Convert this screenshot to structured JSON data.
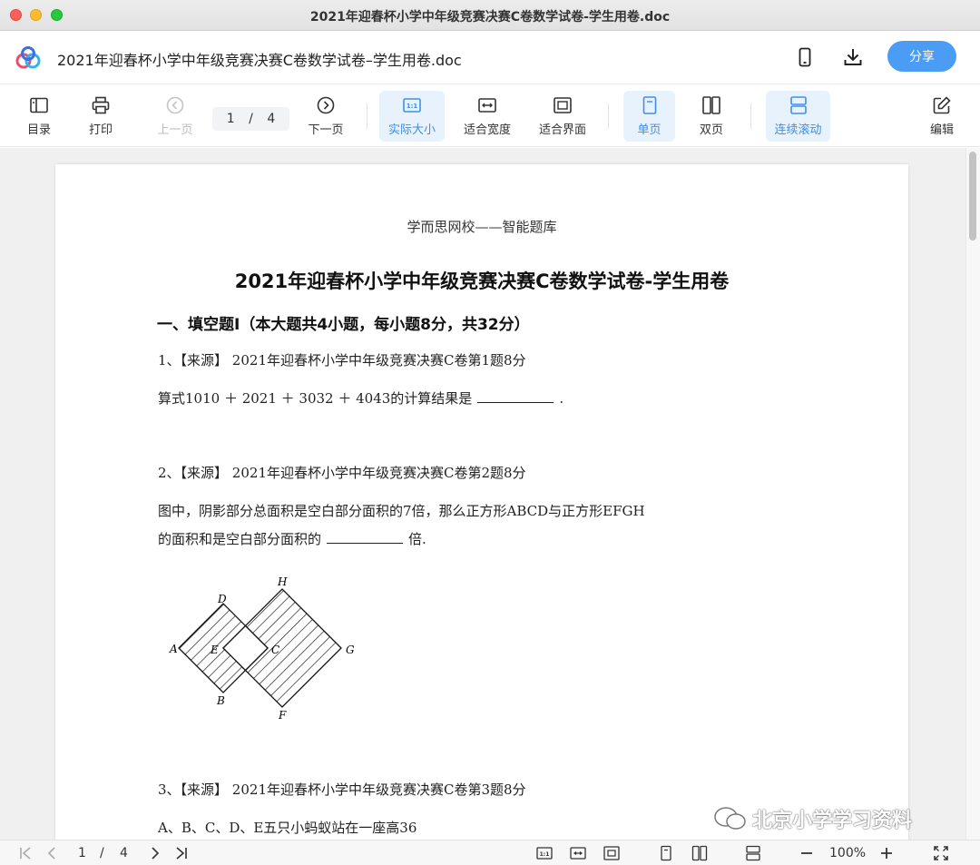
{
  "window": {
    "title": "2021年迎春杯小学中年级竞赛决赛C卷数学试卷-学生用卷.doc"
  },
  "header": {
    "doc_name": "2021年迎春杯小学中年级竞赛决赛C卷数学试卷–学生用卷.doc",
    "share_label": "分享"
  },
  "toolbar": {
    "toc": "目录",
    "print": "打印",
    "prev": "上一页",
    "page_current": "1",
    "page_sep": "/",
    "page_total": "4",
    "next": "下一页",
    "actual_size": "实际大小",
    "fit_width": "适合宽度",
    "fit_screen": "适合界面",
    "single": "单页",
    "double": "双页",
    "continuous": "连续滚动",
    "edit": "编辑"
  },
  "document": {
    "header": "学而思网校——智能题库",
    "title": "2021年迎春杯小学中年级竞赛决赛C卷数学试卷-学生用卷",
    "section": "一、填空题Ⅰ（本大题共4小题，每小题8分，共32分）",
    "q1_source": "1、【来源】 2021年迎春杯小学中年级竞赛决赛C卷第1题8分",
    "q1_text": "算式1010 ＋ 2021 ＋ 3032 ＋ 4043的计算结果是",
    "q1_end": ".",
    "q2_source": "2、【来源】 2021年迎春杯小学中年级竞赛决赛C卷第2题8分",
    "q2_text1": "图中，阴影部分总面积是空白部分面积的7倍，那么正方形ABCD与正方形EFGH",
    "q2_text2": "的面积和是空白部分面积的",
    "q2_end": "倍.",
    "figure_labels": {
      "A": "A",
      "B": "B",
      "C": "C",
      "D": "D",
      "E": "E",
      "F": "F",
      "G": "G",
      "H": "H"
    },
    "q3_source": "3、【来源】 2021年迎春杯小学中年级竞赛决赛C卷第3题8分",
    "q3_text": "A、B、C、D、E五只小蚂蚁站在一座高36"
  },
  "bottombar": {
    "page_current": "1",
    "page_sep": "/",
    "page_total": "4",
    "zoom": "100%"
  },
  "watermark": {
    "text": "北京小学学习资料"
  },
  "colors": {
    "accent": "#4a9cf5",
    "active_bg": "#e8f2fd"
  }
}
